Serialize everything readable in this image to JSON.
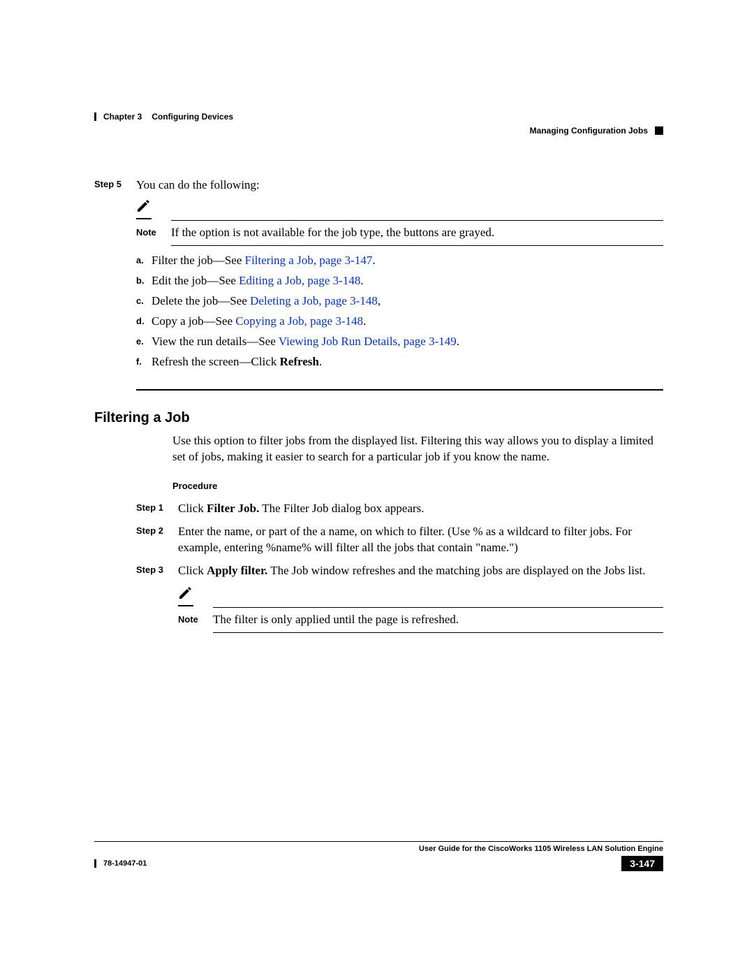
{
  "header": {
    "chapter": "Chapter 3",
    "chapter_title": "Configuring Devices",
    "section": "Managing Configuration Jobs"
  },
  "step5": {
    "label": "Step 5",
    "intro": "You can do the following:",
    "note_label": "Note",
    "note_text": "If the option is not available for the job type, the buttons are grayed.",
    "items": {
      "a": {
        "letter": "a.",
        "pre": "Filter the job—See ",
        "link": "Filtering a Job, page 3-147",
        "post": "."
      },
      "b": {
        "letter": "b.",
        "pre": "Edit the job—See ",
        "link": "Editing a Job, page 3-148",
        "post": "."
      },
      "c": {
        "letter": "c.",
        "pre": "Delete the job—See ",
        "link": "Deleting a Job, page 3-148",
        "post": ","
      },
      "d": {
        "letter": "d.",
        "pre": "Copy a job—See ",
        "link": "Copying a Job, page 3-148",
        "post": "."
      },
      "e": {
        "letter": "e.",
        "pre": "View the run details—See ",
        "link": "Viewing Job Run Details, page 3-149",
        "post": "."
      },
      "f": {
        "letter": "f.",
        "pre": "Refresh the screen—Click ",
        "bold": "Refresh",
        "post": "."
      }
    }
  },
  "filtering": {
    "heading": "Filtering a Job",
    "intro": "Use this option to filter jobs from the displayed list. Filtering this way allows you to display a limited set of jobs, making it easier to search for a particular job if you know the name.",
    "procedure_label": "Procedure",
    "steps": {
      "s1": {
        "label": "Step 1",
        "pre": "Click ",
        "bold": "Filter Job.",
        "post": " The Filter Job dialog box appears."
      },
      "s2": {
        "label": "Step 2",
        "text": "Enter the name, or part of the a name, on which to filter. (Use % as a wildcard to filter jobs. For example, entering %name% will filter all the jobs that contain \"name.\")"
      },
      "s3": {
        "label": "Step 3",
        "pre": "Click ",
        "bold": "Apply filter.",
        "post": " The Job window refreshes and the matching jobs are displayed on the Jobs list."
      }
    },
    "note_label": "Note",
    "note_text": "The filter is only applied until the page is refreshed."
  },
  "footer": {
    "doc_title": "User Guide for the CiscoWorks 1105 Wireless LAN Solution Engine",
    "doc_number": "78-14947-01",
    "page": "3-147"
  }
}
